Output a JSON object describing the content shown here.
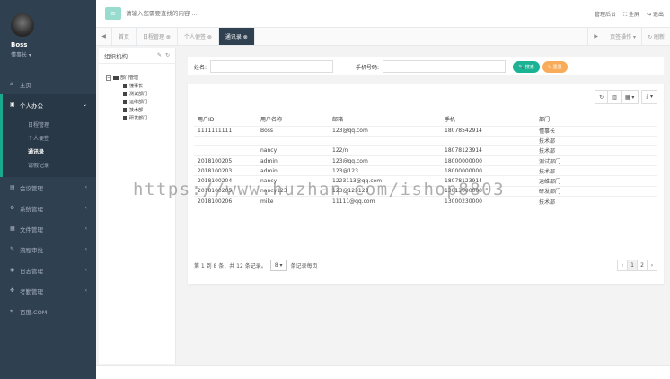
{
  "user": {
    "name": "Boss",
    "role": "懂事长 ▾"
  },
  "topbar": {
    "menu_icon": "≡",
    "search_placeholder": "请输入您需要查找的内容 ...",
    "right_items": [
      "管理后台",
      "⛶ 全屏",
      "↪ 退出"
    ]
  },
  "sidebar": {
    "items": [
      {
        "icon": "⌂",
        "label": "主页"
      },
      {
        "icon": "▣",
        "label": "个人办公"
      },
      {
        "icon": "▤",
        "label": "会议管理"
      },
      {
        "icon": "⚙",
        "label": "系统管理"
      },
      {
        "icon": "▦",
        "label": "文件管理"
      },
      {
        "icon": "✎",
        "label": "流程审批"
      },
      {
        "icon": "◉",
        "label": "日志管理"
      },
      {
        "icon": "✥",
        "label": "考勤管理"
      },
      {
        "icon": "⌖",
        "label": "百度.COM"
      }
    ],
    "sub_items": [
      "日程管理",
      "个人便签",
      "通讯录",
      "请假记录"
    ]
  },
  "tabs": {
    "items": [
      "首页",
      "日程管理 ⊗",
      "个人便签 ⊗",
      "通讯录 ⊗"
    ],
    "right_op": "页签操作 ▾",
    "right_refresh": "↻ 刷新"
  },
  "tree": {
    "title": "组织机构",
    "root": "部门管理",
    "nodes": [
      "懂事长",
      "测试部门",
      "运维部门",
      "技术部",
      "研发部门"
    ]
  },
  "search": {
    "name_label": "姓名:",
    "phone_label": "手机号码:",
    "search_btn": "🔍 搜索",
    "reset_btn": "↻ 重置"
  },
  "table": {
    "columns": [
      "用户ID",
      "用户名称",
      "邮箱",
      "手机",
      "部门"
    ],
    "rows": [
      [
        "1111111111",
        "Boss",
        "123@qq.com",
        "18078542914",
        "懂事长"
      ],
      [
        "",
        "",
        "",
        "",
        "技术部"
      ],
      [
        "",
        "nancy",
        "122/n",
        "18078123914",
        "技术部"
      ],
      [
        "2018100205",
        "admin",
        "123@qq.com",
        "18000000000",
        "测试部门"
      ],
      [
        "2018100203",
        "admin",
        "123@123",
        "18000000000",
        "技术部"
      ],
      [
        "2018100204",
        "nancy",
        "1223113@qq.com",
        "18078123914",
        "运维部门"
      ],
      [
        "2018100205",
        "nancy123",
        "123@123123",
        "13013000000",
        "研发部门"
      ],
      [
        "2018100206",
        "mike",
        "11111@qq.com",
        "13000230000",
        "技术部"
      ]
    ]
  },
  "pager": {
    "info": "第 1 到 8 条，共 12 条记录。",
    "size": "8 ▾",
    "size_suffix": "条记录每页",
    "pages": [
      "‹",
      "1",
      "2",
      "›"
    ]
  },
  "watermark": "https://www.huzhan.com/ishop8803"
}
